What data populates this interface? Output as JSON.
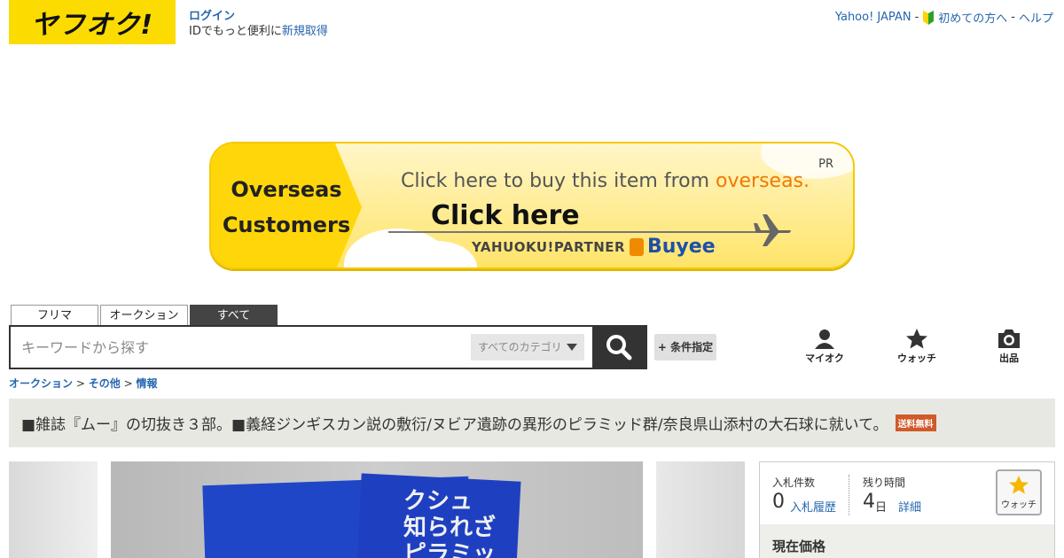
{
  "header": {
    "logo_text": "ヤフオク!",
    "login_label": "ログイン",
    "signup_prefix": "IDでもっと便利に",
    "signup_link": "新規取得",
    "links": [
      {
        "label": "Yahoo! JAPAN"
      },
      {
        "label": "初めての方へ"
      },
      {
        "label": "ヘルプ"
      }
    ]
  },
  "banner": {
    "left_line1": "Overseas",
    "left_line2": "Customers",
    "pr": "PR",
    "line1_prefix": "Click here to buy this item from ",
    "line1_accent": "overseas.",
    "click_here": "Click here",
    "partner": "YAHUOKU!PARTNER",
    "brand": "Buyee"
  },
  "search": {
    "tabs": [
      {
        "label": "フリマ"
      },
      {
        "label": "オークション"
      },
      {
        "label": "すべて"
      }
    ],
    "active_tab": 2,
    "placeholder": "キーワードから探す",
    "category_label": "すべてのカテゴリ",
    "advanced_label": "+ 条件指定"
  },
  "nav_icons": [
    {
      "label": "マイオク",
      "icon": "user-icon"
    },
    {
      "label": "ウォッチ",
      "icon": "star-icon"
    },
    {
      "label": "出品",
      "icon": "camera-icon"
    }
  ],
  "breadcrumb": [
    {
      "label": "オークション"
    },
    {
      "label": "その他"
    },
    {
      "label": "情報"
    }
  ],
  "item": {
    "title": "■雑誌『ムー』の切抜き３部。■義経ジンギスカン説の敷衍/ヌビア遺跡の異形のピラミッド群/奈良県山添村の大石球に就いて。",
    "shipping_badge": "送料無料",
    "image_text": "クシュ\n知られざ\nピラミッ"
  },
  "bid_panel": {
    "bid_count_label": "入札件数",
    "bid_count": "0",
    "bid_history": "入札履歴",
    "remaining_label": "残り時間",
    "remaining_value": "4",
    "remaining_unit": "日",
    "detail": "詳細",
    "watch_label": "ウォッチ",
    "price_label": "現在価格"
  },
  "colors": {
    "brand_yellow": "#fcdc00",
    "link_blue": "#2566af",
    "badge_orange": "#d05a28"
  }
}
